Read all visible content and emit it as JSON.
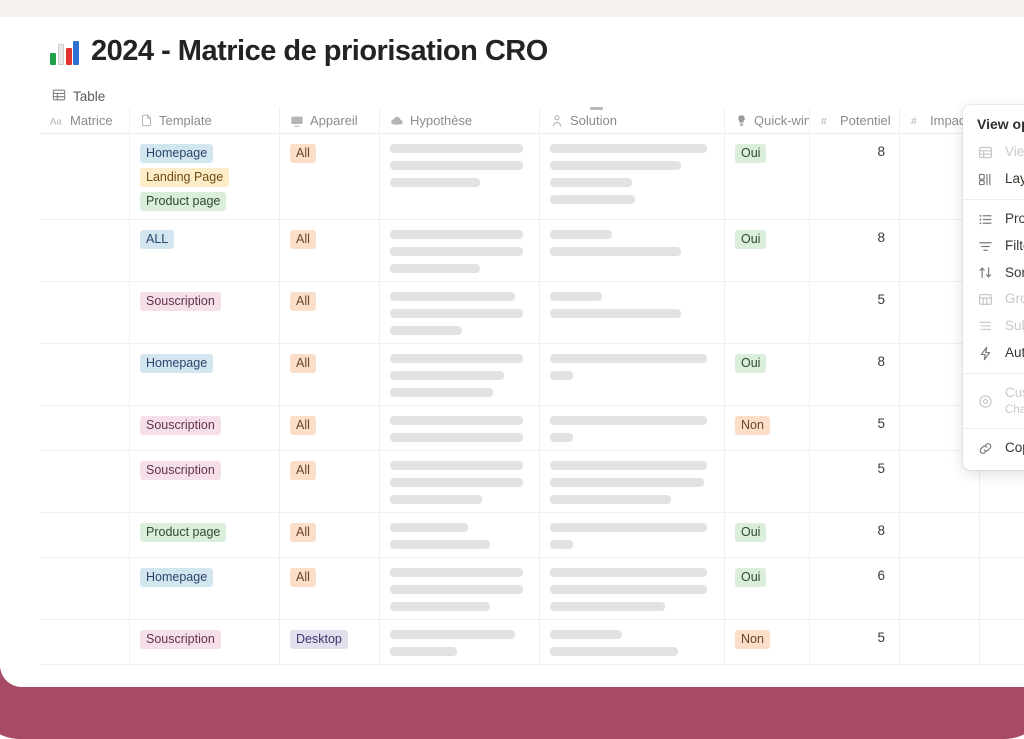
{
  "page": {
    "title": "2024 - Matrice de priorisation CRO",
    "emoji_name": "bar-chart-emoji",
    "view_tab_label": "Table",
    "view_tab_icon": "table-icon"
  },
  "table": {
    "columns": [
      {
        "label": "Matrice",
        "icon": "title-text-icon"
      },
      {
        "label": "Template",
        "icon": "file-icon"
      },
      {
        "label": "Appareil",
        "icon": "monitor-icon"
      },
      {
        "label": "Hypothèse",
        "icon": "cloud-icon"
      },
      {
        "label": "Solution",
        "icon": "person-idea-icon"
      },
      {
        "label": "Quick-win",
        "icon": "lightbulb-icon"
      },
      {
        "label": "Potentiel",
        "icon": "number-icon"
      },
      {
        "label": "Impact",
        "icon": "number-icon"
      }
    ],
    "rows": [
      {
        "matrice": "",
        "templates": [
          {
            "label": "Homepage",
            "color": "blue"
          },
          {
            "label": "Landing Page",
            "color": "yellow"
          },
          {
            "label": "Product page",
            "color": "green"
          }
        ],
        "appareil": {
          "label": "All",
          "color": "orange"
        },
        "hypothese_bars": [
          96,
          96,
          65
        ],
        "solution_bars": [
          96,
          80,
          50,
          52
        ],
        "quickwin": {
          "label": "Oui",
          "color": "green"
        },
        "potentiel": "8",
        "impact": ""
      },
      {
        "matrice": "",
        "templates": [
          {
            "label": "ALL",
            "color": "blue"
          }
        ],
        "appareil": {
          "label": "All",
          "color": "orange"
        },
        "hypothese_bars": [
          96,
          96,
          65
        ],
        "solution_bars": [
          38,
          80
        ],
        "quickwin": {
          "label": "Oui",
          "color": "green"
        },
        "potentiel": "8",
        "impact": ""
      },
      {
        "matrice": "",
        "templates": [
          {
            "label": "Souscription",
            "color": "pink"
          }
        ],
        "appareil": {
          "label": "All",
          "color": "orange"
        },
        "hypothese_bars": [
          90,
          96,
          52
        ],
        "solution_bars": [
          32,
          80
        ],
        "quickwin": null,
        "potentiel": "5",
        "impact": ""
      },
      {
        "matrice": "",
        "templates": [
          {
            "label": "Homepage",
            "color": "blue"
          }
        ],
        "appareil": {
          "label": "All",
          "color": "orange"
        },
        "hypothese_bars": [
          96,
          82,
          74
        ],
        "solution_bars": [
          96,
          14
        ],
        "quickwin": {
          "label": "Oui",
          "color": "green"
        },
        "potentiel": "8",
        "impact": ""
      },
      {
        "matrice": "",
        "templates": [
          {
            "label": "Souscription",
            "color": "pink"
          }
        ],
        "appareil": {
          "label": "All",
          "color": "orange"
        },
        "hypothese_bars": [
          96,
          96
        ],
        "solution_bars": [
          96,
          14
        ],
        "quickwin": {
          "label": "Non",
          "color": "orange"
        },
        "potentiel": "5",
        "impact": ""
      },
      {
        "matrice": "",
        "templates": [
          {
            "label": "Souscription",
            "color": "pink"
          }
        ],
        "appareil": {
          "label": "All",
          "color": "orange"
        },
        "hypothese_bars": [
          96,
          96,
          66
        ],
        "solution_bars": [
          96,
          94,
          74
        ],
        "quickwin": null,
        "potentiel": "5",
        "impact": ""
      },
      {
        "matrice": "",
        "templates": [
          {
            "label": "Product page",
            "color": "green"
          }
        ],
        "appareil": {
          "label": "All",
          "color": "orange"
        },
        "hypothese_bars": [
          56,
          72
        ],
        "solution_bars": [
          96,
          14
        ],
        "quickwin": {
          "label": "Oui",
          "color": "green"
        },
        "potentiel": "8",
        "impact": ""
      },
      {
        "matrice": "",
        "templates": [
          {
            "label": "Homepage",
            "color": "blue"
          }
        ],
        "appareil": {
          "label": "All",
          "color": "orange"
        },
        "hypothese_bars": [
          96,
          96,
          72
        ],
        "solution_bars": [
          96,
          96,
          70
        ],
        "quickwin": {
          "label": "Oui",
          "color": "green"
        },
        "potentiel": "6",
        "impact": ""
      },
      {
        "matrice": "",
        "templates": [
          {
            "label": "Souscription",
            "color": "pink"
          }
        ],
        "appareil": {
          "label": "Desktop",
          "color": "purple"
        },
        "hypothese_bars": [
          90,
          48
        ],
        "solution_bars": [
          44,
          78
        ],
        "quickwin": {
          "label": "Non",
          "color": "orange"
        },
        "potentiel": "5",
        "impact": ""
      }
    ]
  },
  "view_options": {
    "title": "View options",
    "items": [
      {
        "label": "View",
        "icon": "table-icon",
        "dim": true,
        "sub": ""
      },
      {
        "label": "Layout",
        "icon": "layout-icon",
        "dim": false,
        "sub": ""
      },
      {
        "label": "Properties",
        "icon": "properties-icon",
        "dim": false,
        "sub": ""
      },
      {
        "label": "Filter",
        "icon": "filter-icon",
        "dim": false,
        "sub": ""
      },
      {
        "label": "Sort",
        "icon": "sort-icon",
        "dim": false,
        "sub": ""
      },
      {
        "label": "Group",
        "icon": "group-icon",
        "dim": true,
        "sub": ""
      },
      {
        "label": "Sub-items",
        "icon": "sub-items-icon",
        "dim": true,
        "sub": ""
      },
      {
        "label": "Automations",
        "icon": "lightning-icon",
        "dim": false,
        "sub": ""
      },
      {
        "label": "Customize",
        "icon": "customize-icon",
        "dim": true,
        "sub": "Changes apply to everyone"
      },
      {
        "label": "Copy link",
        "icon": "link-icon",
        "dim": false,
        "sub": ""
      }
    ]
  },
  "colors": {
    "frame": "#a74a63",
    "top_band": "#f8f2ee",
    "skeleton": "#e2e2e2"
  }
}
